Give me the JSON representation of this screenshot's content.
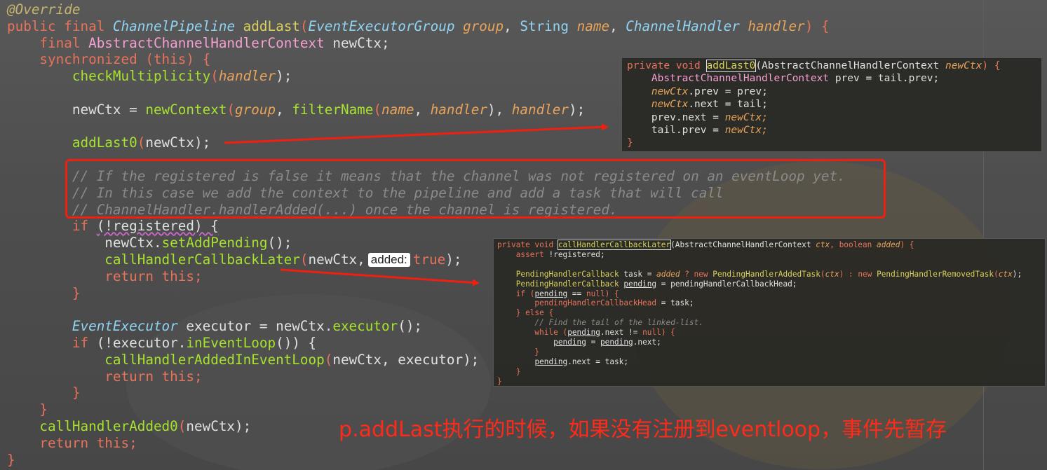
{
  "editor": {
    "main_code": [
      [
        {
          "t": "@Override",
          "c": "ann"
        }
      ],
      [
        {
          "t": "public final ",
          "c": "kw"
        },
        {
          "t": "ChannelPipeline",
          "c": "ityp"
        },
        {
          "t": " addLast",
          "c": "fn2"
        },
        {
          "t": "(",
          "c": "brace"
        },
        {
          "t": "EventExecutorGroup",
          "c": "ityp"
        },
        {
          "t": " group",
          "c": "param"
        },
        {
          "t": ", ",
          "c": "plain"
        },
        {
          "t": "String",
          "c": "cls"
        },
        {
          "t": " name",
          "c": "param"
        },
        {
          "t": ", ",
          "c": "plain"
        },
        {
          "t": "ChannelHandler",
          "c": "ityp"
        },
        {
          "t": " handler",
          "c": "param"
        },
        {
          "t": ") {",
          "c": "brace"
        }
      ],
      [
        {
          "t": "    final ",
          "c": "kw"
        },
        {
          "t": "AbstractChannelHandlerContext",
          "c": "typ"
        },
        {
          "t": " newCtx;",
          "c": "plain"
        }
      ],
      [
        {
          "t": "    synchronized ",
          "c": "kw"
        },
        {
          "t": "(",
          "c": "brace"
        },
        {
          "t": "this",
          "c": "kw"
        },
        {
          "t": ") {",
          "c": "brace"
        }
      ],
      [
        {
          "t": "        checkMultiplicity",
          "c": "fn"
        },
        {
          "t": "(",
          "c": "brace"
        },
        {
          "t": "handler",
          "c": "param"
        },
        {
          "t": ");",
          "c": "plain"
        }
      ],
      [
        {
          "t": "",
          "c": "plain"
        }
      ],
      [
        {
          "t": "        newCtx = ",
          "c": "plain"
        },
        {
          "t": "newContext",
          "c": "fn"
        },
        {
          "t": "(",
          "c": "brace"
        },
        {
          "t": "group",
          "c": "param"
        },
        {
          "t": ", ",
          "c": "plain"
        },
        {
          "t": "filterName",
          "c": "fn"
        },
        {
          "t": "(",
          "c": "brace"
        },
        {
          "t": "name",
          "c": "param"
        },
        {
          "t": ", ",
          "c": "plain"
        },
        {
          "t": "handler",
          "c": "param"
        },
        {
          "t": "), ",
          "c": "plain"
        },
        {
          "t": "handler",
          "c": "param"
        },
        {
          "t": ");",
          "c": "plain"
        }
      ],
      [
        {
          "t": "",
          "c": "plain"
        }
      ],
      [
        {
          "t": "        addLast0",
          "c": "fn"
        },
        {
          "t": "(",
          "c": "brace"
        },
        {
          "t": "newCtx",
          "c": "plain"
        },
        {
          "t": ");",
          "c": "plain"
        }
      ],
      [
        {
          "t": "",
          "c": "plain"
        }
      ],
      [
        {
          "t": "        // If the registered is false it means that the channel was not registered on an eventLoop yet.",
          "c": "cmt"
        }
      ],
      [
        {
          "t": "        // In this case we add the context to the pipeline and add a task that will call",
          "c": "cmt"
        }
      ],
      [
        {
          "t": "        // ChannelHandler.handlerAdded(...) once the channel is registered.",
          "c": "cmt"
        }
      ],
      [
        {
          "t": "        if ",
          "c": "kw"
        },
        {
          "t": "(!registered) {",
          "c": "plain",
          "u": true
        }
      ],
      [
        {
          "t": "            newCtx.",
          "c": "plain"
        },
        {
          "t": "setAddPending",
          "c": "fn"
        },
        {
          "t": "();",
          "c": "plain"
        }
      ],
      [
        {
          "t": "            callHandlerCallbackLater",
          "c": "fn"
        },
        {
          "t": "(",
          "c": "brace"
        },
        {
          "t": "newCtx,",
          "c": "plain"
        },
        {
          "h": "added:"
        },
        {
          "t": "true",
          "c": "kw"
        },
        {
          "t": ");",
          "c": "plain"
        }
      ],
      [
        {
          "t": "            return this;",
          "c": "kw"
        }
      ],
      [
        {
          "t": "        }",
          "c": "brace"
        }
      ],
      [
        {
          "t": "",
          "c": "plain"
        }
      ],
      [
        {
          "t": "        EventExecutor",
          "c": "ityp"
        },
        {
          "t": " executor = newCtx.",
          "c": "plain"
        },
        {
          "t": "executor",
          "c": "fn"
        },
        {
          "t": "();",
          "c": "plain"
        }
      ],
      [
        {
          "t": "        if ",
          "c": "kw"
        },
        {
          "t": "(!executor.",
          "c": "plain"
        },
        {
          "t": "inEventLoop",
          "c": "fn"
        },
        {
          "t": "()) {",
          "c": "plain"
        }
      ],
      [
        {
          "t": "            callHandlerAddedInEventLoop",
          "c": "fn"
        },
        {
          "t": "(",
          "c": "brace"
        },
        {
          "t": "newCtx, executor);",
          "c": "plain"
        }
      ],
      [
        {
          "t": "            return this;",
          "c": "kw"
        }
      ],
      [
        {
          "t": "        }",
          "c": "brace"
        }
      ],
      [
        {
          "t": "    }",
          "c": "brace"
        }
      ],
      [
        {
          "t": "    callHandlerAdded0",
          "c": "fn"
        },
        {
          "t": "(",
          "c": "brace"
        },
        {
          "t": "newCtx);",
          "c": "plain"
        }
      ],
      [
        {
          "t": "    return this;",
          "c": "kw"
        }
      ],
      [
        {
          "t": "}",
          "c": "brace"
        }
      ]
    ]
  },
  "popup_add_last0": [
    [
      {
        "t": "private void ",
        "c": "kw"
      },
      {
        "t": "addLast0",
        "c": "fn2",
        "b": true
      },
      {
        "t": "(AbstractChannelHandlerContext ",
        "c": "plain"
      },
      {
        "t": "newCtx",
        "c": "param"
      },
      {
        "t": ") {",
        "c": "brace"
      }
    ],
    [
      {
        "t": "    AbstractChannelHandlerContext ",
        "c": "typ"
      },
      {
        "t": "prev = ",
        "c": "plain"
      },
      {
        "t": "tail",
        "c": "plain"
      },
      {
        "t": ".prev;",
        "c": "plain"
      }
    ],
    [
      {
        "t": "    newCtx",
        "c": "param"
      },
      {
        "t": ".prev = prev;",
        "c": "plain"
      }
    ],
    [
      {
        "t": "    newCtx",
        "c": "param"
      },
      {
        "t": ".next = tail;",
        "c": "plain"
      }
    ],
    [
      {
        "t": "    prev.next = ",
        "c": "plain"
      },
      {
        "t": "newCtx;",
        "c": "param"
      }
    ],
    [
      {
        "t": "    tail.prev = ",
        "c": "plain"
      },
      {
        "t": "newCtx;",
        "c": "param"
      }
    ],
    [
      {
        "t": "}",
        "c": "brace"
      }
    ]
  ],
  "popup_callback_later": [
    [
      {
        "t": "private void ",
        "c": "kw"
      },
      {
        "t": "callHandlerCallbackLater",
        "c": "fn2",
        "b": true
      },
      {
        "t": "(AbstractChannelHandlerContext ",
        "c": "plain"
      },
      {
        "t": "ctx",
        "c": "param"
      },
      {
        "t": ", boolean ",
        "c": "kw"
      },
      {
        "t": "added",
        "c": "param"
      },
      {
        "t": ") {",
        "c": "brace"
      }
    ],
    [
      {
        "t": "    assert ",
        "c": "kw"
      },
      {
        "t": "!registered;",
        "c": "plain"
      }
    ],
    [
      {
        "t": "",
        "c": "plain"
      }
    ],
    [
      {
        "t": "    PendingHandlerCallback ",
        "c": "fn2"
      },
      {
        "t": "task = ",
        "c": "plain"
      },
      {
        "t": "added",
        "c": "param"
      },
      {
        "t": " ? new ",
        "c": "kw"
      },
      {
        "t": "PendingHandlerAddedTask",
        "c": "fn2"
      },
      {
        "t": "(",
        "c": "brace"
      },
      {
        "t": "ctx",
        "c": "param"
      },
      {
        "t": ") : new ",
        "c": "kw"
      },
      {
        "t": "PendingHandlerRemovedTask",
        "c": "fn2"
      },
      {
        "t": "(",
        "c": "brace"
      },
      {
        "t": "ctx",
        "c": "param"
      },
      {
        "t": ");",
        "c": "plain"
      }
    ],
    [
      {
        "t": "    PendingHandlerCallback ",
        "c": "fn2"
      },
      {
        "t": "pending",
        "c": "plain",
        "ul": true
      },
      {
        "t": " = pendingHandlerCallbackHead;",
        "c": "plain"
      }
    ],
    [
      {
        "t": "    if ",
        "c": "kw"
      },
      {
        "t": "(",
        "c": "brace"
      },
      {
        "t": "pending",
        "c": "plain",
        "ul": true
      },
      {
        "t": " == ",
        "c": "plain"
      },
      {
        "t": "null",
        "c": "kw"
      },
      {
        "t": ") {",
        "c": "brace"
      }
    ],
    [
      {
        "t": "        pendingHandlerCallbackHead",
        "c": "kw"
      },
      {
        "t": " = task;",
        "c": "plain"
      }
    ],
    [
      {
        "t": "    } else {",
        "c": "kw"
      }
    ],
    [
      {
        "t": "        // Find the tail of the linked-list.",
        "c": "cmt"
      }
    ],
    [
      {
        "t": "        while ",
        "c": "kw"
      },
      {
        "t": "(",
        "c": "brace"
      },
      {
        "t": "pending",
        "c": "plain",
        "ul": true
      },
      {
        "t": ".next != ",
        "c": "plain"
      },
      {
        "t": "null",
        "c": "kw"
      },
      {
        "t": ") {",
        "c": "brace"
      }
    ],
    [
      {
        "t": "            ",
        "c": "plain"
      },
      {
        "t": "pending",
        "c": "plain",
        "ul": true
      },
      {
        "t": " = ",
        "c": "plain"
      },
      {
        "t": "pending",
        "c": "plain",
        "ul": true
      },
      {
        "t": ".next;",
        "c": "plain"
      }
    ],
    [
      {
        "t": "        }",
        "c": "brace"
      }
    ],
    [
      {
        "t": "        ",
        "c": "plain"
      },
      {
        "t": "pending",
        "c": "plain",
        "ul": true
      },
      {
        "t": ".next = task;",
        "c": "plain"
      }
    ],
    [
      {
        "t": "    }",
        "c": "brace"
      }
    ],
    [
      {
        "t": "}",
        "c": "brace"
      }
    ]
  ],
  "annotation": {
    "note": "p.addLast执行的时候，如果没有注册到eventloop，事件先暂存",
    "highlight_color": "#f02010",
    "note_color": "#ff2a1a"
  }
}
